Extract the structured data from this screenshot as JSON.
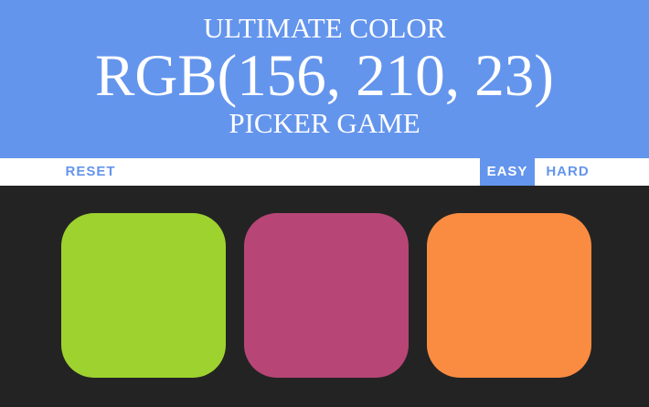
{
  "header": {
    "title_top": "ULTIMATE COLOR",
    "target_rgb": "RGB(156, 210, 23)",
    "title_bottom": "PICKER GAME"
  },
  "controls": {
    "reset_label": "RESET",
    "easy_label": "EASY",
    "hard_label": "HARD",
    "selected_mode": "EASY"
  },
  "colors": {
    "accent": "#6495ed",
    "background": "#232323"
  },
  "squares": [
    {
      "color": "#9ed22f"
    },
    {
      "color": "#b74676"
    },
    {
      "color": "#fa8c42"
    }
  ]
}
